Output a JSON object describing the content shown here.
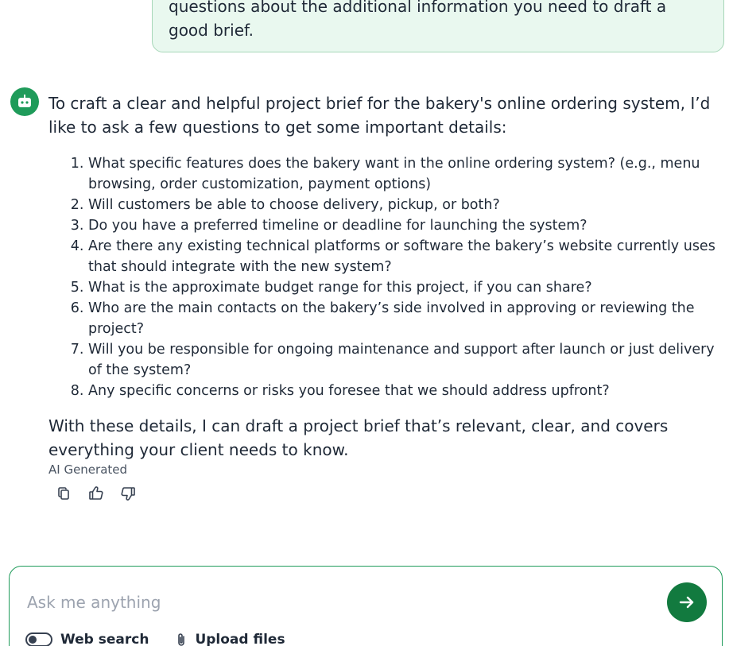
{
  "user_message": {
    "text": "questions about the additional information you need to draft a good brief."
  },
  "bot_message": {
    "intro": "To craft a clear and helpful project brief for the bakery's online ordering system, I’d like to ask a few questions to get some important details:",
    "questions": [
      "What specific features does the bakery want in the online ordering system? (e.g., menu browsing, order customization, payment options)",
      "Will customers be able to choose delivery, pickup, or both?",
      "Do you have a preferred timeline or deadline for launching the system?",
      "Are there any existing technical platforms or software the bakery’s website currently uses that should integrate with the new system?",
      "What is the approximate budget range for this project, if you can share?",
      "Who are the main contacts on the bakery’s side involved in approving or reviewing the project?",
      "Will you be responsible for ongoing maintenance and support after launch or just delivery of the system?",
      "Any specific concerns or risks you foresee that we should address upfront?"
    ],
    "outro": "With these details, I can draft a project brief that’s relevant, clear, and covers everything your client needs to know.",
    "ai_label": "AI Generated"
  },
  "actions": {
    "icons": [
      "copy-icon",
      "thumbs-up-icon",
      "thumbs-down-icon"
    ]
  },
  "composer": {
    "placeholder": "Ask me anything",
    "value": "",
    "web_search_label": "Web search",
    "upload_label": "Upload files"
  },
  "colors": {
    "accent": "#1f9b5a",
    "send_button": "#127a3f",
    "user_bubble_bg": "#e9f8ef",
    "user_bubble_border": "#a7d7b8"
  }
}
